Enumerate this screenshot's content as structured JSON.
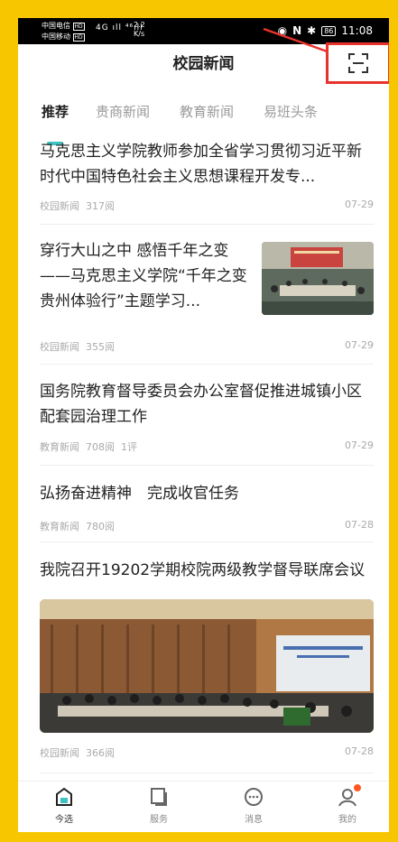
{
  "status_bar": {
    "carrier1": "中国电信",
    "carrier2": "中国移动",
    "carrier1_badge": "HD",
    "carrier2_badge": "HD",
    "signal": "4G ıll ⁴⁶ıll",
    "speed_value": "2.2",
    "speed_unit": "K/s",
    "battery": "86",
    "time": "11:08"
  },
  "header": {
    "title": "校园新闻"
  },
  "tabs": [
    {
      "label": "推荐",
      "active": true
    },
    {
      "label": "贵商新闻",
      "active": false
    },
    {
      "label": "教育新闻",
      "active": false
    },
    {
      "label": "易班头条",
      "active": false
    }
  ],
  "news": [
    {
      "title": "马克思主义学院教师参加全省学习贯彻习近平新时代中国特色社会主义思想课程开发专...",
      "source": "校园新闻",
      "reads": "317阅",
      "comments": "",
      "date": "07-29"
    },
    {
      "title": "穿行大山之中 感悟千年之变——马克思主义学院“千年之变贵州体验行”主题学习...",
      "source": "校园新闻",
      "reads": "355阅",
      "comments": "",
      "date": "07-29"
    },
    {
      "title": "国务院教育督导委员会办公室督促推进城镇小区配套园治理工作",
      "source": "教育新闻",
      "reads": "708阅",
      "comments": "1评",
      "date": "07-29"
    },
    {
      "title": "弘扬奋进精神　完成收官任务",
      "source": "教育新闻",
      "reads": "780阅",
      "comments": "",
      "date": "07-28"
    },
    {
      "title": "我院召开19202学期校院两级教学督导联席会议",
      "source": "校园新闻",
      "reads": "366阅",
      "comments": "",
      "date": "07-28"
    }
  ],
  "bottom_nav": [
    {
      "label": "今选",
      "icon": "home-icon",
      "active": true
    },
    {
      "label": "服务",
      "icon": "service-icon",
      "active": false
    },
    {
      "label": "消息",
      "icon": "message-icon",
      "active": false
    },
    {
      "label": "我的",
      "icon": "profile-icon",
      "active": false
    }
  ],
  "colors": {
    "accent": "#3dc1c1",
    "highlight_box": "#e8332d",
    "background_band": "#f7c600",
    "notification_dot": "#ff5722"
  }
}
